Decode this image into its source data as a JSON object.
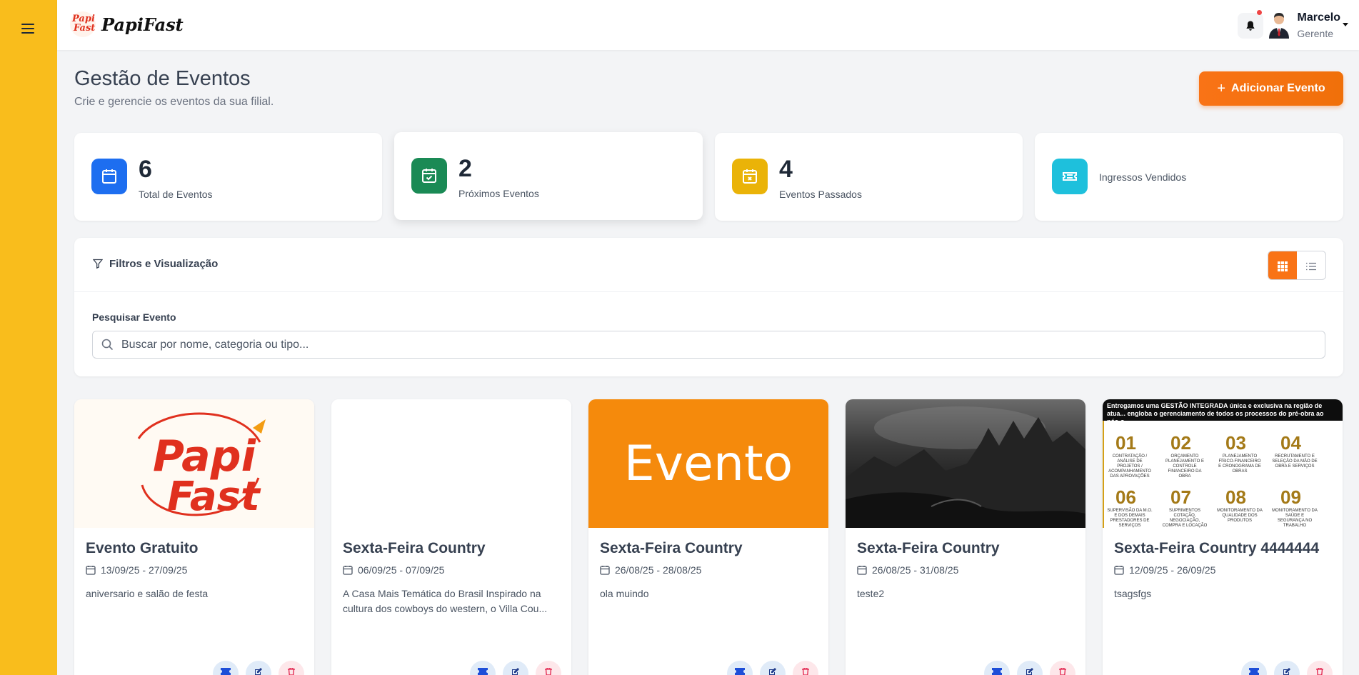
{
  "app": {
    "logo_small_line1": "Papi",
    "logo_small_line2": "Fast",
    "logo_text": "PapiFast"
  },
  "user": {
    "name": "Marcelo",
    "role": "Gerente"
  },
  "page": {
    "title": "Gestão de Eventos",
    "subtitle": "Crie e gerencie os eventos da sua filial.",
    "add_button": "Adicionar Evento"
  },
  "stats": [
    {
      "value": "6",
      "label": "Total de Eventos",
      "color": "#1d6ef0",
      "icon": "calendar-icon"
    },
    {
      "value": "2",
      "label": "Próximos Eventos",
      "color": "#1a8a55",
      "icon": "calendar-check-icon"
    },
    {
      "value": "4",
      "label": "Eventos Passados",
      "color": "#eab308",
      "icon": "calendar-x-icon"
    },
    {
      "value": "",
      "label": "Ingressos Vendidos",
      "color": "#1ec0dc",
      "icon": "ticket-icon"
    }
  ],
  "filters": {
    "title": "Filtros e Visualização",
    "search_label": "Pesquisar Evento",
    "search_placeholder": "Buscar por nome, categoria ou tipo...",
    "view_mode": "grid"
  },
  "events": [
    {
      "title": "Evento Gratuito",
      "dates": "13/09/25 - 27/09/25",
      "description": "aniversario e salão de festa",
      "image": "papifast-logo",
      "image_text_1": "Papi",
      "image_text_2": "Fast"
    },
    {
      "title": "Sexta-Feira Country",
      "dates": "06/09/25 - 07/09/25",
      "description": "A Casa Mais Temática do Brasil Inspirado na cultura dos cowboys do western, o Villa Cou...",
      "image": "blank"
    },
    {
      "title": "Sexta-Feira Country",
      "dates": "26/08/25 - 28/08/25",
      "description": "ola muindo",
      "image": "evento-placeholder",
      "image_text": "Evento"
    },
    {
      "title": "Sexta-Feira Country",
      "dates": "26/08/25 - 31/08/25",
      "description": "teste2",
      "image": "dark-landscape"
    },
    {
      "title": "Sexta-Feira Country 4444444",
      "dates": "12/09/25 - 26/09/25",
      "description": "tsagsfgs",
      "image": "info-graphic",
      "banner_text": "Entregamos uma GESTÃO INTEGRADA única e exclusiva na região de atua... engloba o gerenciamento de todos os processos do pré-obra ao pós-o...",
      "steps": [
        {
          "n": "01",
          "t": "CONTRATAÇÃO / ANÁLISE DE PROJETOS / ACOMPANHAMENTO DAS APROVAÇÕES"
        },
        {
          "n": "02",
          "t": "ORÇAMENTO PLANEJAMENTO E CONTROLE FINANCEIRO DA OBRA"
        },
        {
          "n": "03",
          "t": "PLANEJAMENTO FÍSICO-FINANCEIRO E CRONOGRAMA DE OBRAS"
        },
        {
          "n": "04",
          "t": "RECRUTAMENTO E SELEÇÃO DA MÃO DE OBRA E SERVIÇOS"
        },
        {
          "n": "",
          "t": ""
        },
        {
          "n": "06",
          "t": "SUPERVISÃO DA M.O. E DOS DEMAIS PRESTADORES DE SERVIÇOS"
        },
        {
          "n": "07",
          "t": "SUPRIMENTOS COTAÇÃO, NEGOCIAÇÃO, COMPRA E LOCAÇÃO"
        },
        {
          "n": "08",
          "t": "MONITORAMENTO DA QUALIDADE DOS PRODUTOS"
        },
        {
          "n": "09",
          "t": "MONITORAMENTO DA SAÚDE E SEGURANÇA NO TRABALHO"
        },
        {
          "n": "",
          "t": ""
        }
      ]
    }
  ]
}
